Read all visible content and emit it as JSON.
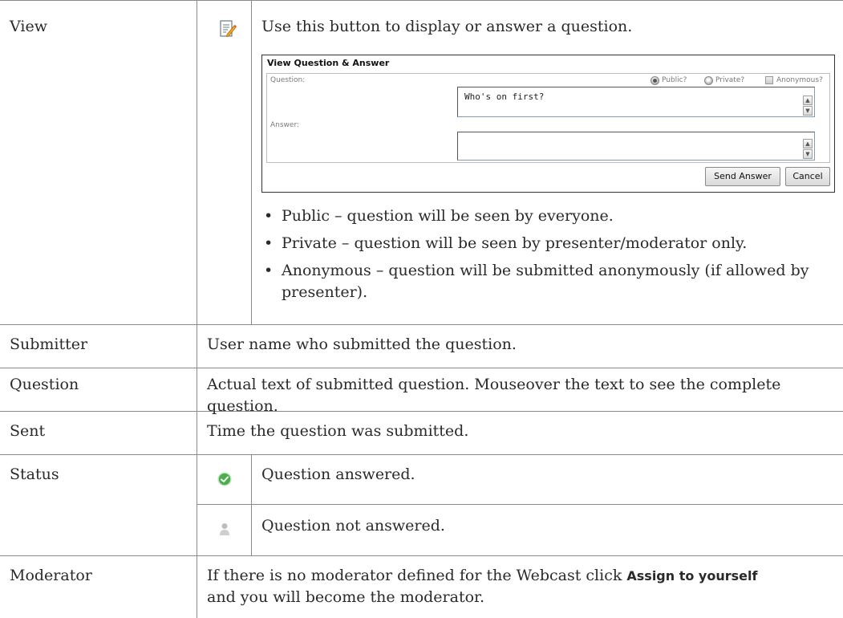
{
  "rows": {
    "view": {
      "label": "View",
      "description": "Use this button to display or answer a question.",
      "icon": "edit-note-icon",
      "screenshot": {
        "title": "View Question & Answer",
        "question_label": "Question:",
        "public_label": "Public?",
        "private_label": "Private?",
        "anonymous_label": "Anonymous?",
        "question_text": "Who's on first?",
        "answer_label": "Answer:",
        "answer_text": "",
        "send_button": "Send Answer",
        "cancel_button": "Cancel"
      },
      "bullets": [
        "Public – question will be seen by everyone.",
        "Private – question will be seen by presenter/moderator only.",
        "Anonymous – question will be submitted anonymously (if allowed by presenter)."
      ]
    },
    "submitter": {
      "label": "Submitter",
      "description": "User name who submitted the question."
    },
    "question": {
      "label": "Question",
      "description": "Actual text of submitted question. Mouseover the text to see the complete question."
    },
    "sent": {
      "label": "Sent",
      "description": "Time the question was submitted."
    },
    "status": {
      "label": "Status",
      "answered": {
        "icon": "green-check-icon",
        "text": "Question answered."
      },
      "not_answered": {
        "icon": "gray-user-icon",
        "text": "Question not answered."
      }
    },
    "moderator": {
      "label": "Moderator",
      "text_before": "If there is no moderator defined for the Webcast click ",
      "bold": "Assign to yourself",
      "text_after": " and you will become the moderator."
    }
  },
  "colors": {
    "border": "#8a8a8a",
    "check_green": "#4cae4c",
    "text": "#2a2a2a"
  }
}
